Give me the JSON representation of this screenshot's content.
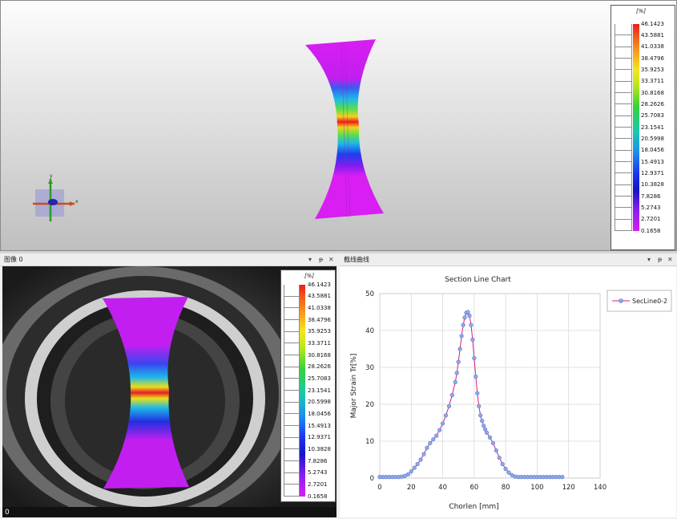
{
  "legend_unit": "[%]",
  "legend_values": [
    "46.1423",
    "43.5881",
    "41.0338",
    "38.4796",
    "35.9253",
    "33.3711",
    "30.8168",
    "28.2626",
    "25.7083",
    "23.1541",
    "20.5998",
    "18.0456",
    "15.4913",
    "12.9371",
    "10.3828",
    "7.8286",
    "5.2743",
    "2.7201",
    "0.1658"
  ],
  "axis_labels": {
    "y": "y",
    "x": "x"
  },
  "image_panel": {
    "title": "图像 0",
    "frame": "0"
  },
  "chart_panel": {
    "title": "截线曲线"
  },
  "panel_controls": {
    "dropdown": "▾",
    "pin": "ᵽ",
    "close": "✕"
  },
  "chart_data": {
    "type": "line",
    "title": "Section Line Chart",
    "xlabel": "Chorlen [mm]",
    "ylabel": "Major Strain Tr[%]",
    "xlim": [
      0,
      140
    ],
    "ylim": [
      0,
      50
    ],
    "xticks": [
      "0",
      "20",
      "40",
      "60",
      "80",
      "100",
      "120",
      "140"
    ],
    "yticks": [
      "0",
      "10",
      "20",
      "30",
      "40",
      "50"
    ],
    "grid": true,
    "legend_position": "top-right",
    "series": [
      {
        "name": "SecLine0-2",
        "color": "#e0197a",
        "marker_color": "#8fa8e8",
        "x": [
          0,
          2,
          4,
          6,
          8,
          10,
          12,
          14,
          16,
          18,
          20,
          22,
          24,
          26,
          28,
          30,
          32,
          34,
          36,
          38,
          40,
          42,
          44,
          46,
          48,
          49,
          50,
          51,
          52,
          53,
          54,
          55,
          56,
          57,
          58,
          59,
          60,
          61,
          62,
          63,
          64,
          65,
          66,
          67,
          68,
          70,
          72,
          74,
          76,
          78,
          80,
          82,
          84,
          86,
          88,
          90,
          92,
          94,
          96,
          98,
          100,
          102,
          104,
          106,
          108,
          110,
          112,
          114,
          116
        ],
        "y": [
          0.3,
          0.3,
          0.3,
          0.3,
          0.3,
          0.3,
          0.3,
          0.4,
          0.6,
          1.0,
          1.8,
          2.8,
          3.8,
          5.0,
          6.5,
          8.2,
          9.5,
          10.5,
          11.5,
          13.0,
          14.8,
          17.0,
          19.5,
          22.5,
          26.0,
          28.5,
          31.5,
          35.0,
          38.5,
          41.5,
          43.5,
          44.8,
          45.0,
          44.0,
          41.5,
          37.5,
          32.5,
          27.5,
          23.0,
          19.5,
          17.0,
          15.5,
          14.2,
          13.2,
          12.3,
          11.0,
          9.5,
          7.5,
          5.5,
          3.8,
          2.5,
          1.5,
          0.8,
          0.4,
          0.3,
          0.3,
          0.3,
          0.3,
          0.3,
          0.3,
          0.3,
          0.3,
          0.3,
          0.3,
          0.3,
          0.3,
          0.3,
          0.3,
          0.3
        ]
      }
    ]
  }
}
